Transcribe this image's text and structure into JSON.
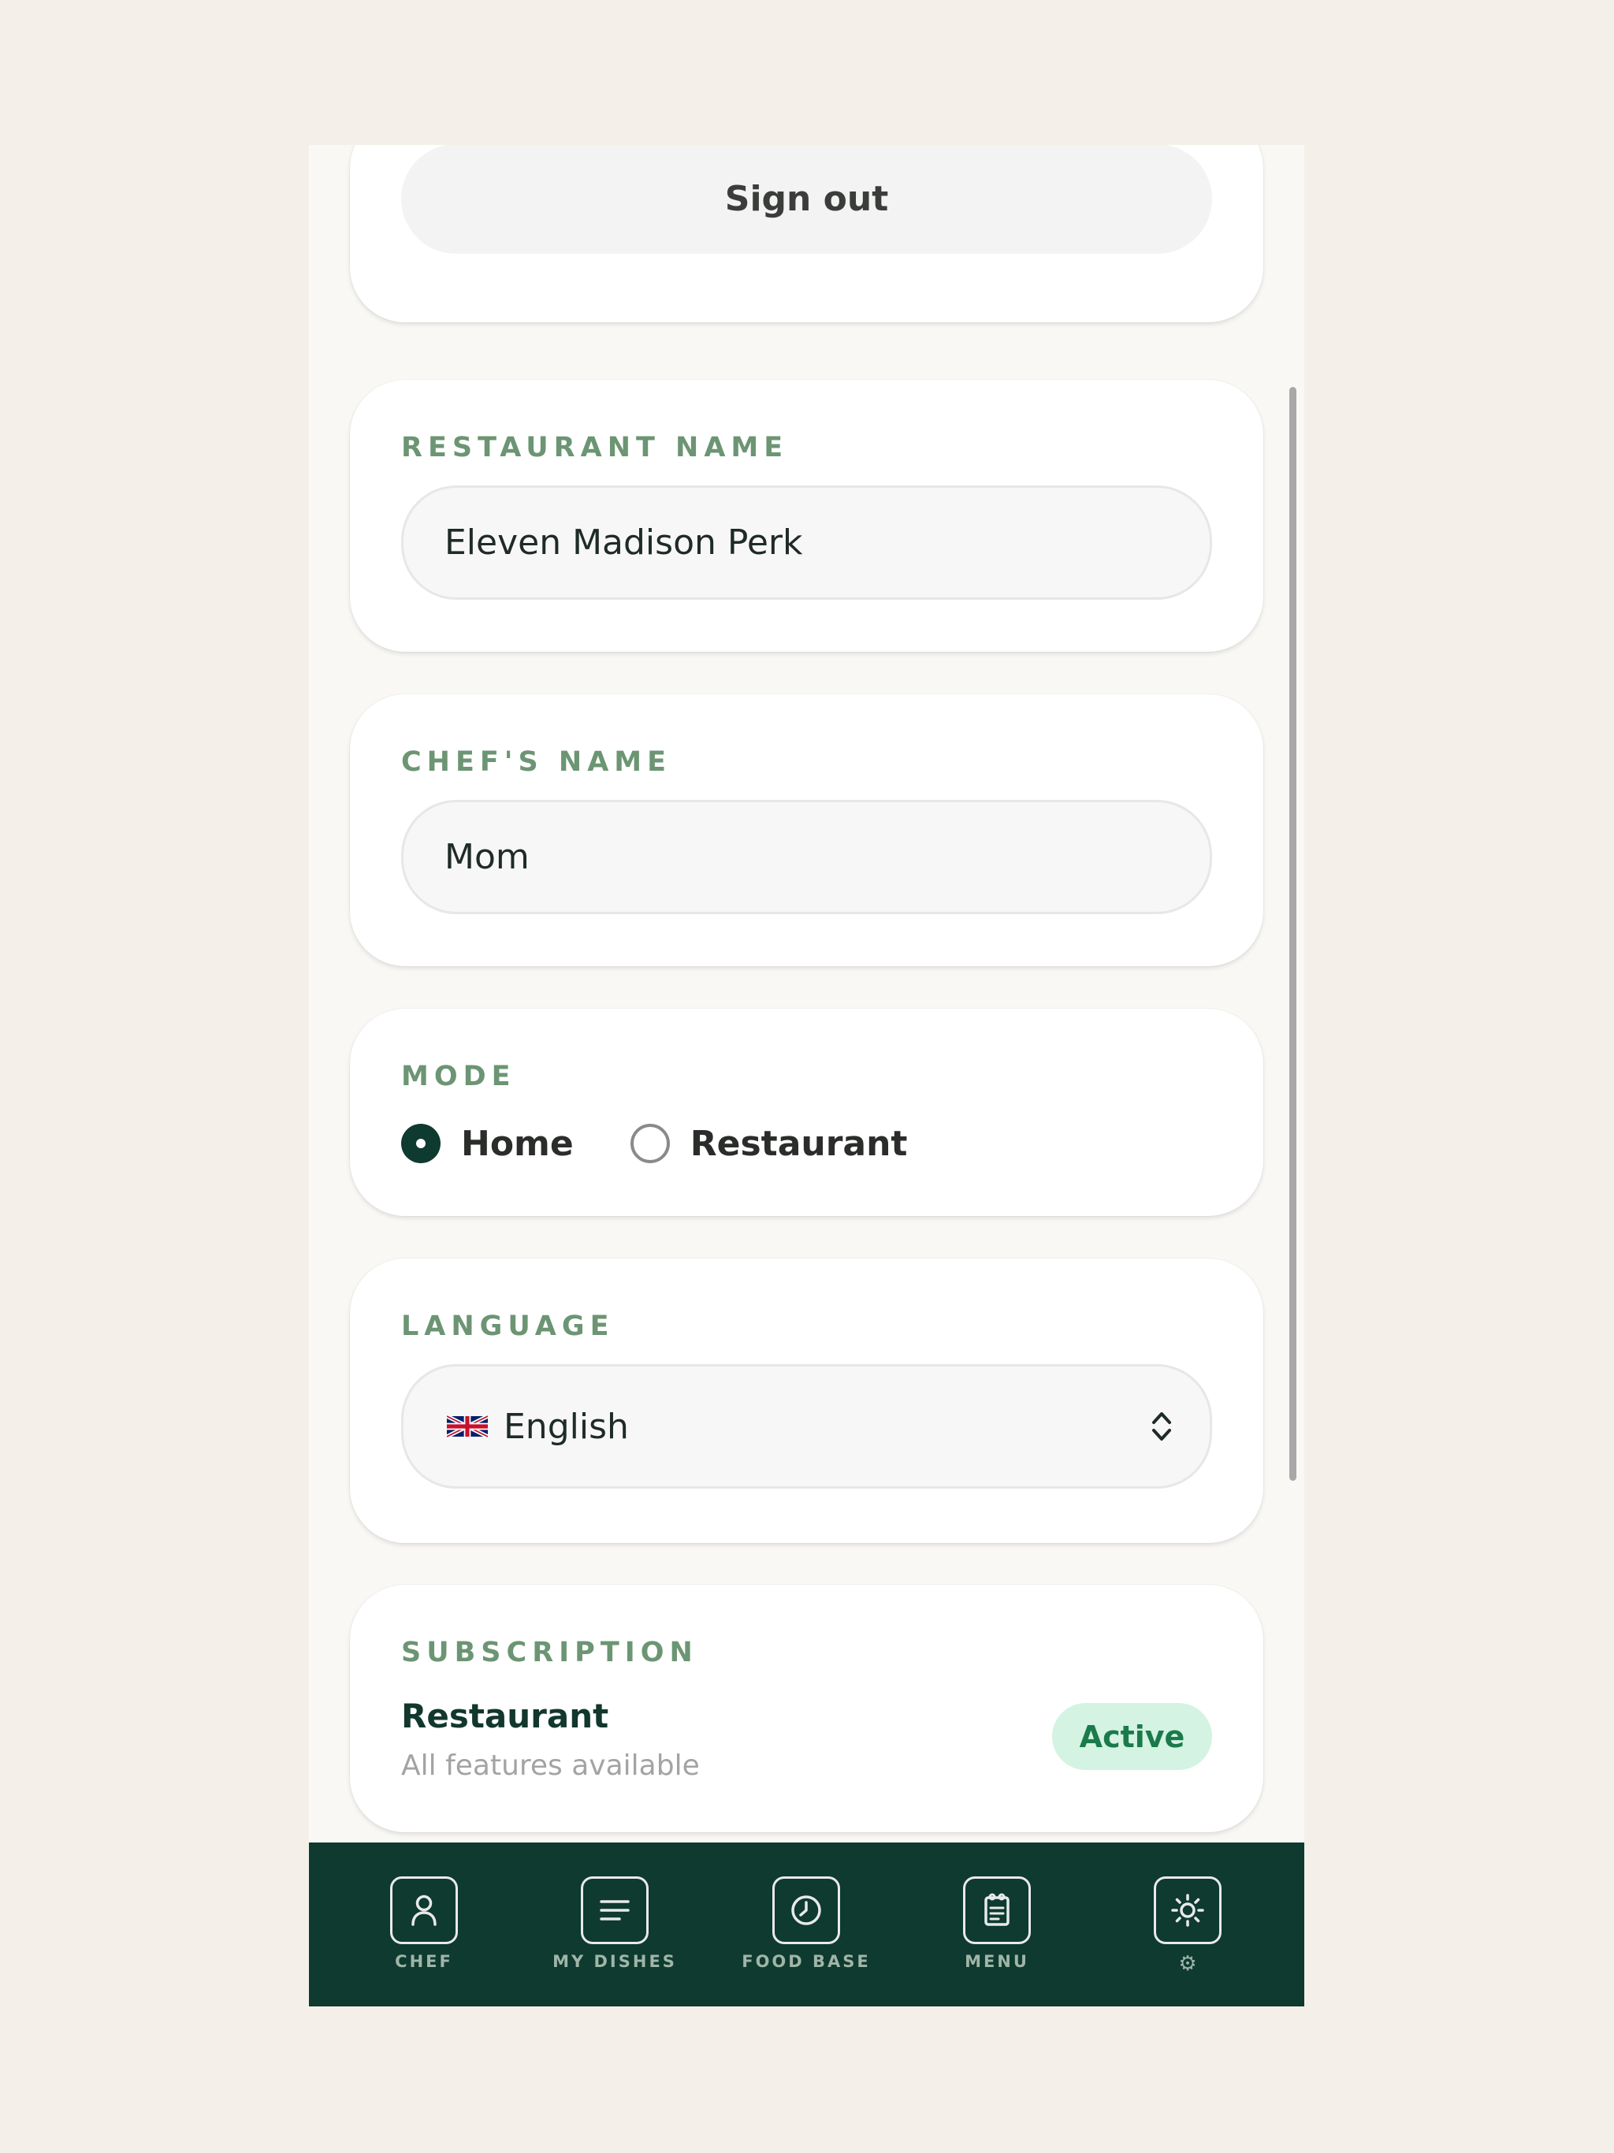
{
  "account": {
    "signout_label": "Sign out"
  },
  "restaurant_name": {
    "label": "RESTAURANT NAME",
    "value": "Eleven Madison Perk"
  },
  "chef_name": {
    "label": "CHEF'S NAME",
    "value": "Mom"
  },
  "mode": {
    "label": "MODE",
    "options": [
      {
        "label": "Home",
        "selected": true
      },
      {
        "label": "Restaurant",
        "selected": false
      }
    ]
  },
  "language": {
    "label": "LANGUAGE",
    "flag_icon": "uk-flag-icon",
    "selected": "English"
  },
  "subscription": {
    "label": "SUBSCRIPTION",
    "plan": "Restaurant",
    "description": "All features available",
    "status": "Active"
  },
  "tabbar": {
    "items": [
      {
        "label": "CHEF",
        "icon": "person-icon"
      },
      {
        "label": "MY DISHES",
        "icon": "list-icon"
      },
      {
        "label": "FOOD BASE",
        "icon": "clock-icon"
      },
      {
        "label": "MENU",
        "icon": "clipboard-icon"
      },
      {
        "label": "⚙",
        "icon": "sun-icon"
      }
    ]
  },
  "colors": {
    "page_background": "#f4f0e9",
    "label_green": "#6c9573",
    "tabbar_green": "#0e3a2f",
    "badge_background": "#d4f3e2",
    "badge_text": "#1b7a4b"
  }
}
